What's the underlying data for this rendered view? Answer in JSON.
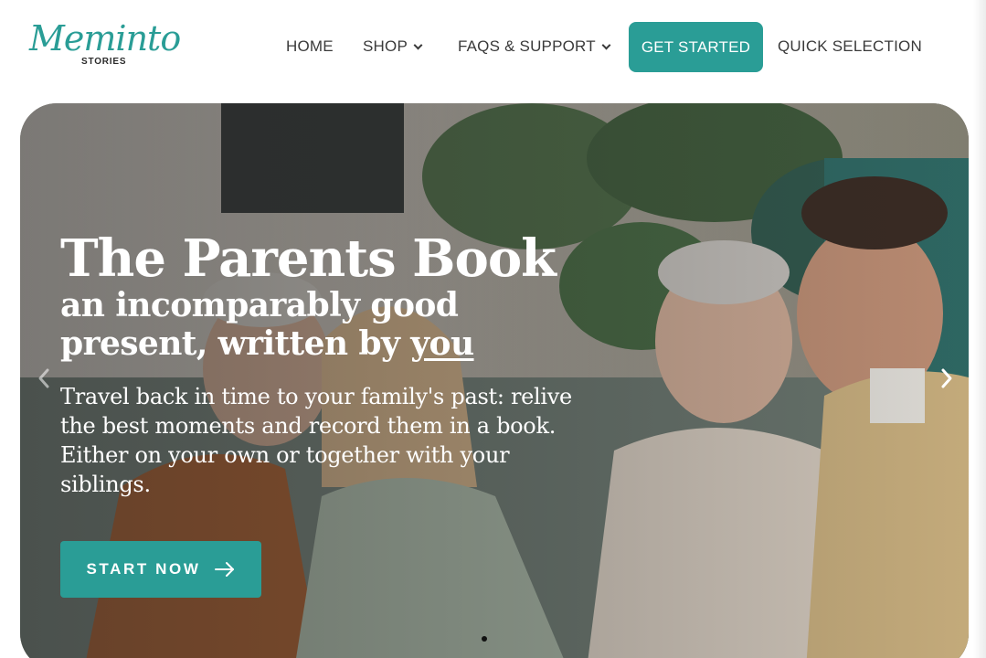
{
  "brand": {
    "logo_script": "Meminto",
    "logo_sub": "STORIES",
    "accent": "#2a9d96"
  },
  "nav": {
    "home": "HOME",
    "shop": "SHOP",
    "faqs": "FAQS & SUPPORT",
    "get_started": "GET STARTED",
    "quick_selection": "QUICK SELECTION"
  },
  "hero": {
    "title": "The Parents Book",
    "subtitle_prefix": "an incomparably good present, written by ",
    "subtitle_emphasis": "you",
    "description": "Travel back in time to your family's past: relive the best moments and record them in a book. Either on your own or together with your siblings.",
    "cta": "START NOW",
    "cta_icon": "arrow-right-icon",
    "prev_icon": "chevron-left-icon",
    "next_icon": "chevron-right-icon"
  }
}
